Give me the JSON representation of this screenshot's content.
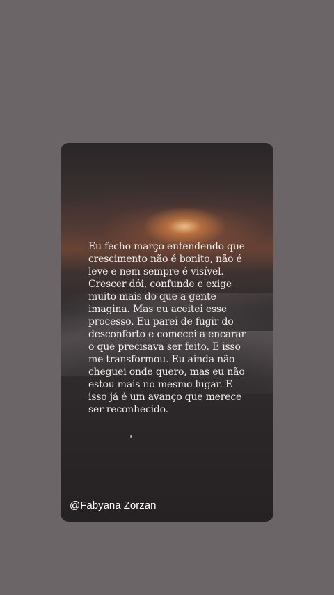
{
  "post": {
    "quote_lines": [
      "Eu fecho março entendendo que",
      "crescimento não é bonito, não é",
      "leve e nem sempre é visível.",
      "Crescer dói, confunde e exige",
      "muito mais do que a gente",
      "imagina. Mas eu aceitei esse",
      "processo. Eu parei de fugir do",
      "desconforto e comecei a encarar",
      "o que precisava ser feito. E isso",
      "me transformou. Eu ainda não",
      "cheguei onde quero, mas eu não",
      "estou mais no mesmo lugar. E",
      "isso já é um avanço que merece",
      "ser reconhecido."
    ],
    "author_handle": "@Fabyana Zorzan"
  },
  "colors": {
    "page_background": "#6b6568",
    "text": "#f2eeec"
  }
}
